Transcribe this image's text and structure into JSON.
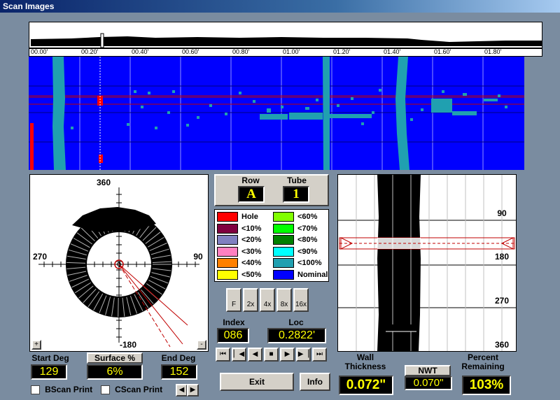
{
  "window": {
    "title": "Scan Images"
  },
  "timeline": {
    "ticks": [
      "00.00'",
      "00.20'",
      "00.40'",
      "00.60'",
      "00.80'",
      "01.00'",
      "01.20'",
      "01.40'",
      "01.60'",
      "01.80'"
    ]
  },
  "polar": {
    "top_label": "360",
    "left_label": "270",
    "right_label": "90",
    "bottom_label": "-180",
    "zoom_in": "+",
    "zoom_out": "-"
  },
  "center_panel": {
    "row_label": "Row",
    "row_value": "A",
    "tube_label": "Tube",
    "tube_value": "1"
  },
  "legend": {
    "left": [
      {
        "label": "Hole",
        "color": "#ff0000"
      },
      {
        "label": "<10%",
        "color": "#800040"
      },
      {
        "label": "<20%",
        "color": "#8080c0"
      },
      {
        "label": "<30%",
        "color": "#ff80c0"
      },
      {
        "label": "<40%",
        "color": "#ff8000"
      },
      {
        "label": "<50%",
        "color": "#ffff00"
      }
    ],
    "right": [
      {
        "label": "<60%",
        "color": "#80ff00"
      },
      {
        "label": "<70%",
        "color": "#00ff00"
      },
      {
        "label": "<80%",
        "color": "#008000"
      },
      {
        "label": "<90%",
        "color": "#00ffff"
      },
      {
        "label": "<100%",
        "color": "#20a0b0"
      },
      {
        "label": "Nominal",
        "color": "#0000ff"
      }
    ]
  },
  "zoom_buttons": [
    "F",
    "2x",
    "4x",
    "8x",
    "16x"
  ],
  "index": {
    "label": "Index",
    "value": "086"
  },
  "loc": {
    "label": "Loc",
    "value": "0.2822'"
  },
  "playback_buttons": [
    "first",
    "step-back",
    "prev",
    "stop",
    "play",
    "step-forward",
    "last"
  ],
  "bscan": {
    "labels": [
      "90",
      "180",
      "270",
      "360"
    ]
  },
  "bottom": {
    "start_deg_label": "Start Deg",
    "start_deg_value": "129",
    "surface_label": "Surface %",
    "surface_value": "6%",
    "end_deg_label": "End Deg",
    "end_deg_value": "152",
    "bscan_print_label": "BScan Print",
    "cscan_print_label": "CScan Print",
    "exit_label": "Exit",
    "info_label": "Info",
    "wall_thickness_label": "Wall Thickness",
    "wall_thickness_value": "0.072\"",
    "nwt_label": "NWT",
    "nwt_value": "0.070\"",
    "percent_remaining_label": "Percent Remaining",
    "percent_remaining_value": "103%"
  },
  "colors": {
    "nominal_blue": "#0000ff",
    "teal": "#20a0b0",
    "hole_red": "#ff0000",
    "display_yellow": "#ffff00"
  }
}
